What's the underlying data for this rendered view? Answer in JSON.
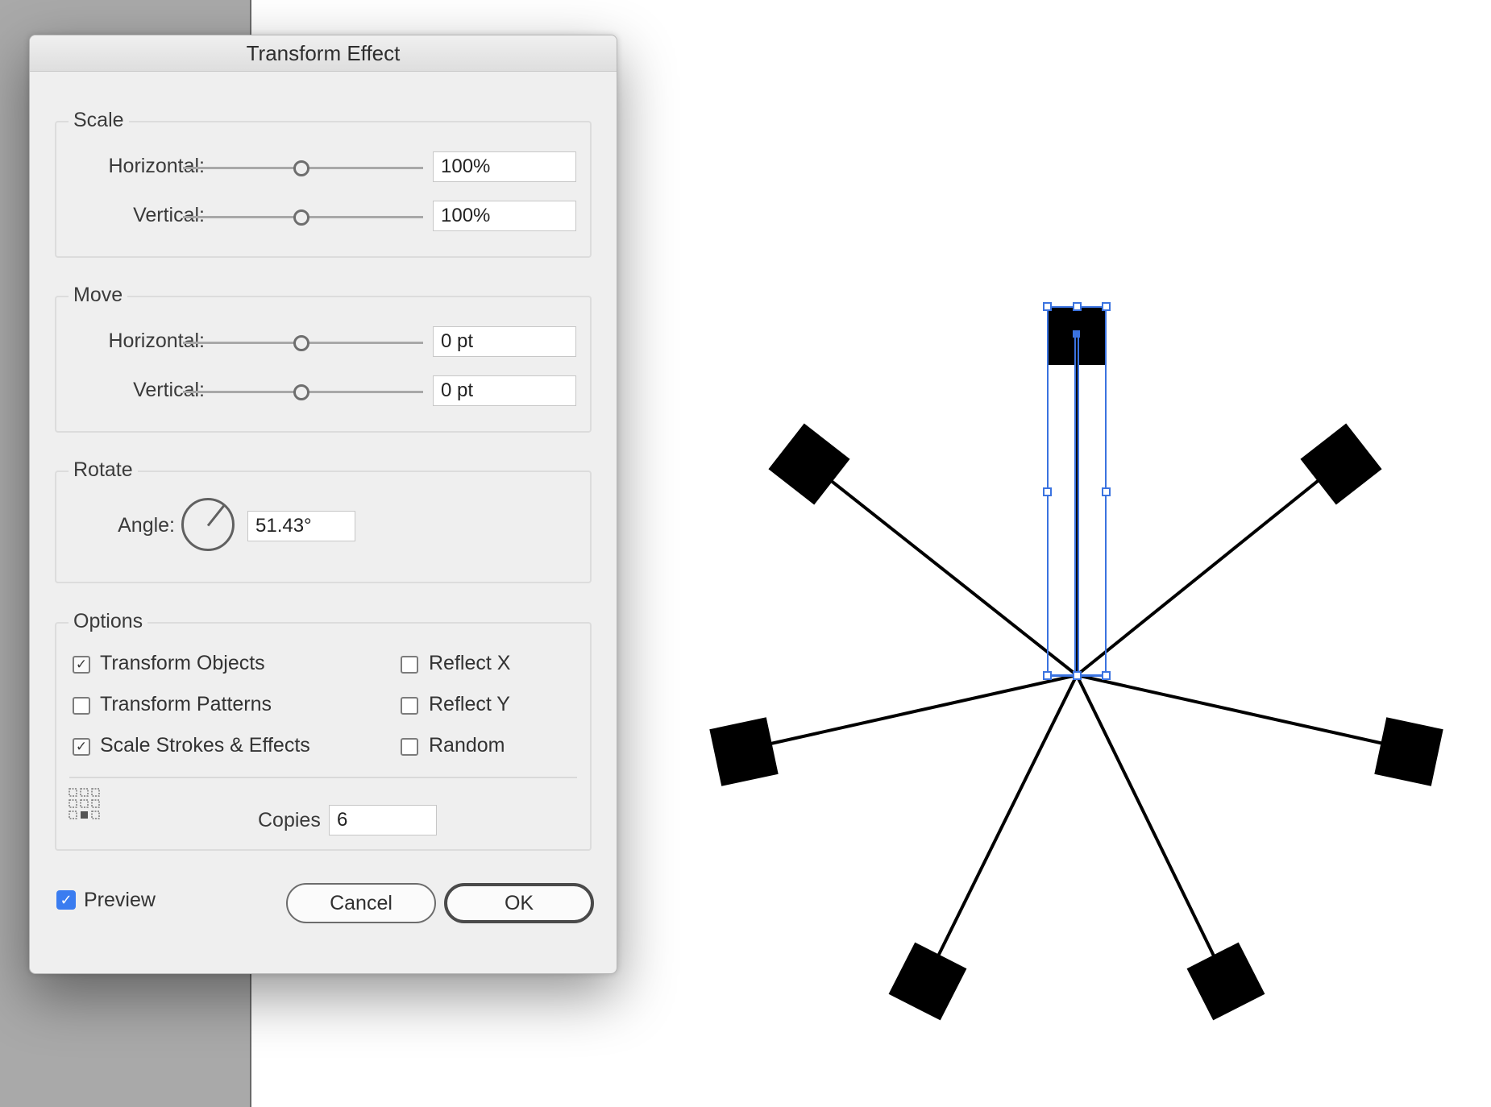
{
  "dialog": {
    "title": "Transform Effect",
    "scale": {
      "legend": "Scale",
      "horizontal_label": "Horizontal:",
      "horizontal_value": "100%",
      "vertical_label": "Vertical:",
      "vertical_value": "100%"
    },
    "move": {
      "legend": "Move",
      "horizontal_label": "Horizontal:",
      "horizontal_value": "0 pt",
      "vertical_label": "Vertical:",
      "vertical_value": "0 pt"
    },
    "rotate": {
      "legend": "Rotate",
      "angle_label": "Angle:",
      "angle_value": "51.43°"
    },
    "options": {
      "legend": "Options",
      "transform_objects": {
        "label": "Transform Objects",
        "checked": true
      },
      "transform_patterns": {
        "label": "Transform Patterns",
        "checked": false
      },
      "scale_strokes": {
        "label": "Scale Strokes & Effects",
        "checked": true
      },
      "reflect_x": {
        "label": "Reflect X",
        "checked": false
      },
      "reflect_y": {
        "label": "Reflect Y",
        "checked": false
      },
      "random": {
        "label": "Random",
        "checked": false
      },
      "reference_point_icon": "reference-point-grid-icon",
      "copies_label": "Copies",
      "copies_value": "6"
    },
    "preview": {
      "label": "Preview",
      "checked": true
    },
    "buttons": {
      "cancel": "Cancel",
      "ok": "OK"
    }
  },
  "canvas": {
    "colors": {
      "shape": "#000000",
      "selection": "#3b73e0",
      "check_accent": "#3a7cf0"
    }
  }
}
